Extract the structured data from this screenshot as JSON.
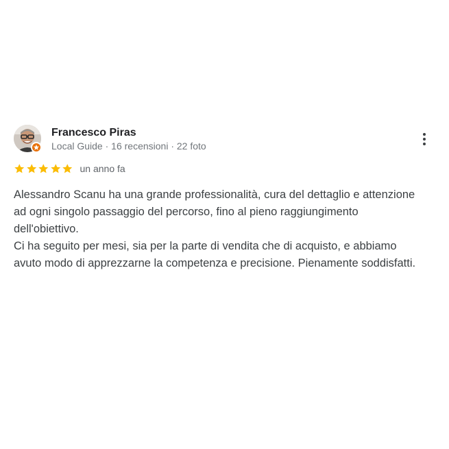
{
  "reviewer": {
    "name": "Francesco Piras",
    "meta": "Local Guide · 16 recensioni · 22 foto"
  },
  "review": {
    "rating": 5,
    "rating_max": 5,
    "date": "un anno fa",
    "paragraphs": [
      "Alessandro Scanu ha una grande professionalità, cura del dettaglio e attenzione ad ogni singolo passaggio del percorso, fino al pieno raggiungimento dell'obiettivo.",
      "Ci ha seguito per mesi, sia per la parte di vendita che di acquisto, e abbiamo avuto modo di apprezzarne la competenza e precisione. Pienamente soddisfatti."
    ]
  },
  "icons": {
    "avatar": "avatar-photo",
    "badge": "local-guide-badge-icon",
    "more": "more-vert-icon",
    "star": "star-icon"
  },
  "colors": {
    "star": "#fbbc04",
    "badge": "#e8710a",
    "meta_text": "#70757a",
    "body_text": "#3c4043"
  }
}
